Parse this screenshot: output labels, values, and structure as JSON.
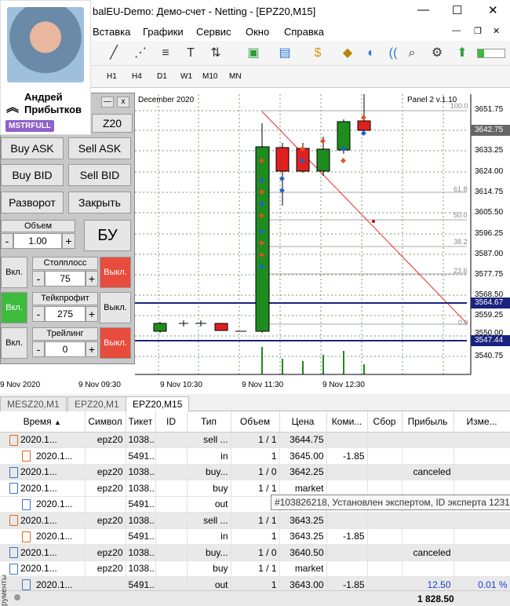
{
  "window": {
    "title": "balEU-Demo: Демо-счет - Netting - [EPZ20,M15]",
    "minimize": "—",
    "maximize": "☐",
    "close": "✕",
    "restore": "❐"
  },
  "menu": [
    "Вставка",
    "Графики",
    "Сервис",
    "Окно",
    "Справка"
  ],
  "timeframes": [
    "H1",
    "H4",
    "D1",
    "W1",
    "M10",
    "MN"
  ],
  "profile": {
    "name": "Андрей Прибытков",
    "badge": "MSTRFULL"
  },
  "panel": {
    "close_x": "x",
    "top_label": "Z20",
    "buy_ask": "Buy ASK",
    "sell_ask": "Sell ASK",
    "buy_bid": "Buy BID",
    "sell_bid": "Sell BID",
    "reverse": "Разворот",
    "close": "Закрыть",
    "volume_label": "Объем",
    "volume_value": "1.00",
    "be": "БУ",
    "minus": "-",
    "plus": "+",
    "sl_label": "Столплосс",
    "sl_value": "75",
    "tp_label": "Тейкпрофит",
    "tp_value": "275",
    "trail_label": "Трейлинг",
    "trail_value": "0",
    "on": "Вкл.",
    "off": "Выкл."
  },
  "chart": {
    "date_label": "December 2020",
    "panel_label": "Panel 2 v.1.10",
    "price_ticks": [
      "3651.75",
      "3642.75",
      "3633.25",
      "3624.00",
      "3614.75",
      "3605.50",
      "3596.25",
      "3587.00",
      "3577.75",
      "3568.50",
      "3564.67",
      "3559.25",
      "3550.00",
      "3547.44",
      "3540.75"
    ],
    "fib_labels": [
      "100.0",
      "61.8",
      "50.0",
      "38.2",
      "23.6",
      "0.0"
    ],
    "time_ticks": [
      "9 Nov 2020",
      "9 Nov 09:30",
      "9 Nov 10:30",
      "9 Nov 11:30",
      "9 Nov 12:30"
    ]
  },
  "tabs": [
    "MESZ20,M1",
    "EPZ20,M1",
    "EPZ20,M15"
  ],
  "table": {
    "headers": [
      "Время",
      "Символ",
      "Тикет",
      "ID",
      "Тип",
      "Объем",
      "Цена",
      "Коми...",
      "Сбор",
      "Прибыль",
      "Изме..."
    ],
    "rows": [
      {
        "icon": "o",
        "indent": 0,
        "time": "2020.1...",
        "symbol": "epz20",
        "ticket": "1038...",
        "id": "",
        "type": "sell ...",
        "volume": "1 / 1",
        "price": "3644.75",
        "comm": "",
        "fee": "",
        "profit": "",
        "change": ""
      },
      {
        "icon": "o-in",
        "indent": 1,
        "time": "2020.1...",
        "symbol": "",
        "ticket": "5491...",
        "id": "",
        "type": "in",
        "volume": "1",
        "price": "3645.00",
        "comm": "-1.85",
        "fee": "",
        "profit": "",
        "change": ""
      },
      {
        "icon": "b",
        "indent": 0,
        "time": "2020.1...",
        "symbol": "epz20",
        "ticket": "1038...",
        "id": "",
        "type": "buy...",
        "volume": "1 / 0",
        "price": "3642.25",
        "comm": "",
        "fee": "",
        "profit": "canceled",
        "change": ""
      },
      {
        "icon": "b",
        "indent": 0,
        "time": "2020.1...",
        "symbol": "epz20",
        "ticket": "1038...",
        "id": "",
        "type": "buy",
        "volume": "1 / 1",
        "price": "market",
        "comm": "",
        "fee": "",
        "profit": "",
        "change": ""
      },
      {
        "icon": "b-out",
        "indent": 1,
        "time": "2020.1...",
        "symbol": "",
        "ticket": "5491...",
        "id": "",
        "type": "out",
        "volume": "1",
        "price": "3642.50",
        "comm": "-1.85",
        "fee": "",
        "profit": "",
        "change": ""
      },
      {
        "icon": "o",
        "indent": 0,
        "time": "2020.1...",
        "symbol": "epz20",
        "ticket": "1038...",
        "id": "",
        "type": "sell ...",
        "volume": "1 / 1",
        "price": "3643.25",
        "comm": "",
        "fee": "",
        "profit": "",
        "change": ""
      },
      {
        "icon": "o-in",
        "indent": 1,
        "time": "2020.1...",
        "symbol": "",
        "ticket": "5491...",
        "id": "",
        "type": "in",
        "volume": "1",
        "price": "3643.25",
        "comm": "-1.85",
        "fee": "",
        "profit": "",
        "change": ""
      },
      {
        "icon": "b",
        "indent": 0,
        "time": "2020.1...",
        "symbol": "epz20",
        "ticket": "1038...",
        "id": "",
        "type": "buy...",
        "volume": "1 / 0",
        "price": "3640.50",
        "comm": "",
        "fee": "",
        "profit": "canceled",
        "change": ""
      },
      {
        "icon": "b",
        "indent": 0,
        "time": "2020.1...",
        "symbol": "epz20",
        "ticket": "1038...",
        "id": "",
        "type": "buy",
        "volume": "1 / 1",
        "price": "market",
        "comm": "",
        "fee": "",
        "profit": "",
        "change": ""
      },
      {
        "icon": "b-out",
        "indent": 1,
        "time": "2020.1...",
        "symbol": "",
        "ticket": "5491...",
        "id": "",
        "type": "out",
        "volume": "1",
        "price": "3643.00",
        "comm": "-1.85",
        "fee": "",
        "profit": "12.50",
        "change": "0.01 %"
      }
    ],
    "total": "1 828.50",
    "tooltip": "#103826218, Установлен экспертом, ID эксперта 1231",
    "sidebar_label": "рументы"
  }
}
